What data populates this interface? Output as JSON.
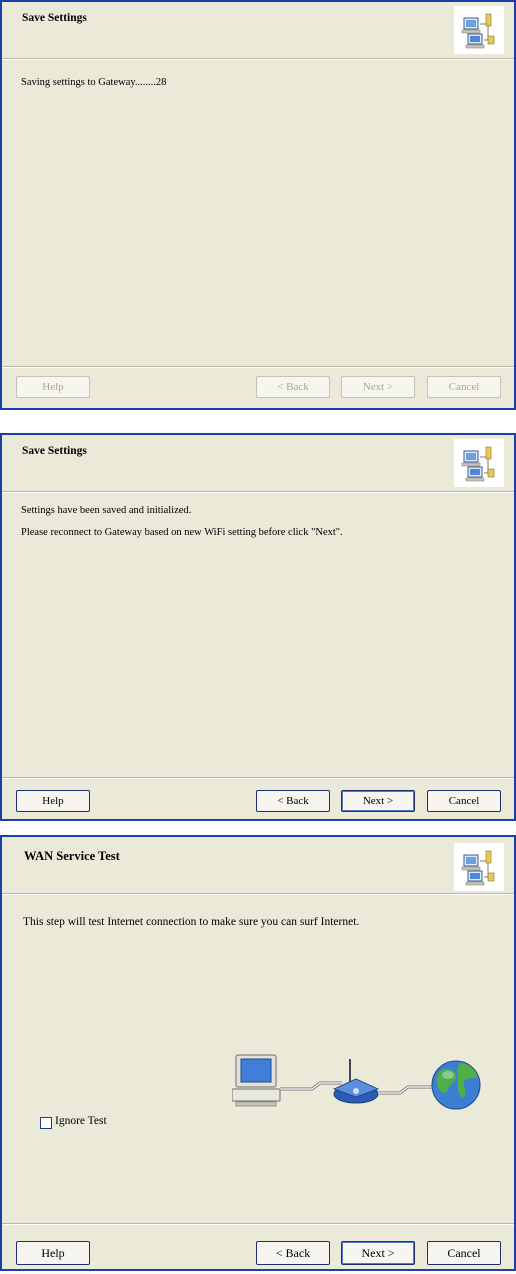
{
  "dialogs": [
    {
      "title": "Save Settings",
      "messages": [
        "Saving settings to Gateway........28"
      ],
      "buttons": {
        "help": "Help",
        "back": "< Back",
        "next": "Next >",
        "cancel": "Cancel"
      },
      "buttons_enabled": false
    },
    {
      "title": "Save Settings",
      "messages": [
        "Settings have been saved and initialized.",
        "Please reconnect to Gateway based on new WiFi setting before click \"Next\"."
      ],
      "buttons": {
        "help": "Help",
        "back": "< Back",
        "next": "Next >",
        "cancel": "Cancel"
      },
      "buttons_enabled": true
    },
    {
      "title": "WAN Service Test",
      "messages": [
        "This step will test Internet connection to make sure you can surf Internet."
      ],
      "checkbox": {
        "label": "Ignore Test",
        "checked": false
      },
      "buttons": {
        "help": "Help",
        "back": "< Back",
        "next": "Next >",
        "cancel": "Cancel"
      },
      "buttons_enabled": true
    }
  ],
  "icons": [
    "network-computers-icon",
    "computer-icon",
    "router-icon",
    "globe-icon"
  ],
  "colors": {
    "dialog_bg": "#ebe9d8",
    "frame_border": "#1b3ea8",
    "disabled_text": "#a9a795"
  }
}
